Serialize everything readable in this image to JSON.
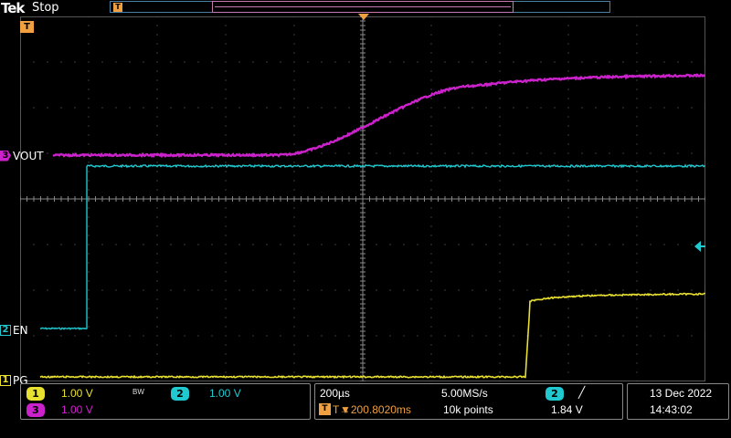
{
  "brand": "Tek",
  "run_state": "Stop",
  "colors": {
    "ch1": "#e8e030",
    "ch2": "#20c8d0",
    "ch3": "#cc22cc",
    "trigger": "#f0a040",
    "grid": "#555555",
    "background": "#000000"
  },
  "channels": {
    "ch1": {
      "num": "1",
      "label": "PG",
      "scale": "1.00 V"
    },
    "ch2": {
      "num": "2",
      "label": "EN",
      "scale": "1.00 V"
    },
    "ch3": {
      "num": "3",
      "label": "VOUT",
      "scale": "1.00 V"
    }
  },
  "bw_flag": "BW",
  "trigger_flag": "T",
  "timebase": {
    "scale": "200µs",
    "sample_rate": "5.00MS/s",
    "record_length": "10k points",
    "position": "▼200.8020ms",
    "position_prefix": "T→"
  },
  "trigger": {
    "source": "2",
    "slope": "╱",
    "level": "1.84 V"
  },
  "datetime": {
    "date": "13 Dec  2022",
    "time": "14:43:02"
  }
}
